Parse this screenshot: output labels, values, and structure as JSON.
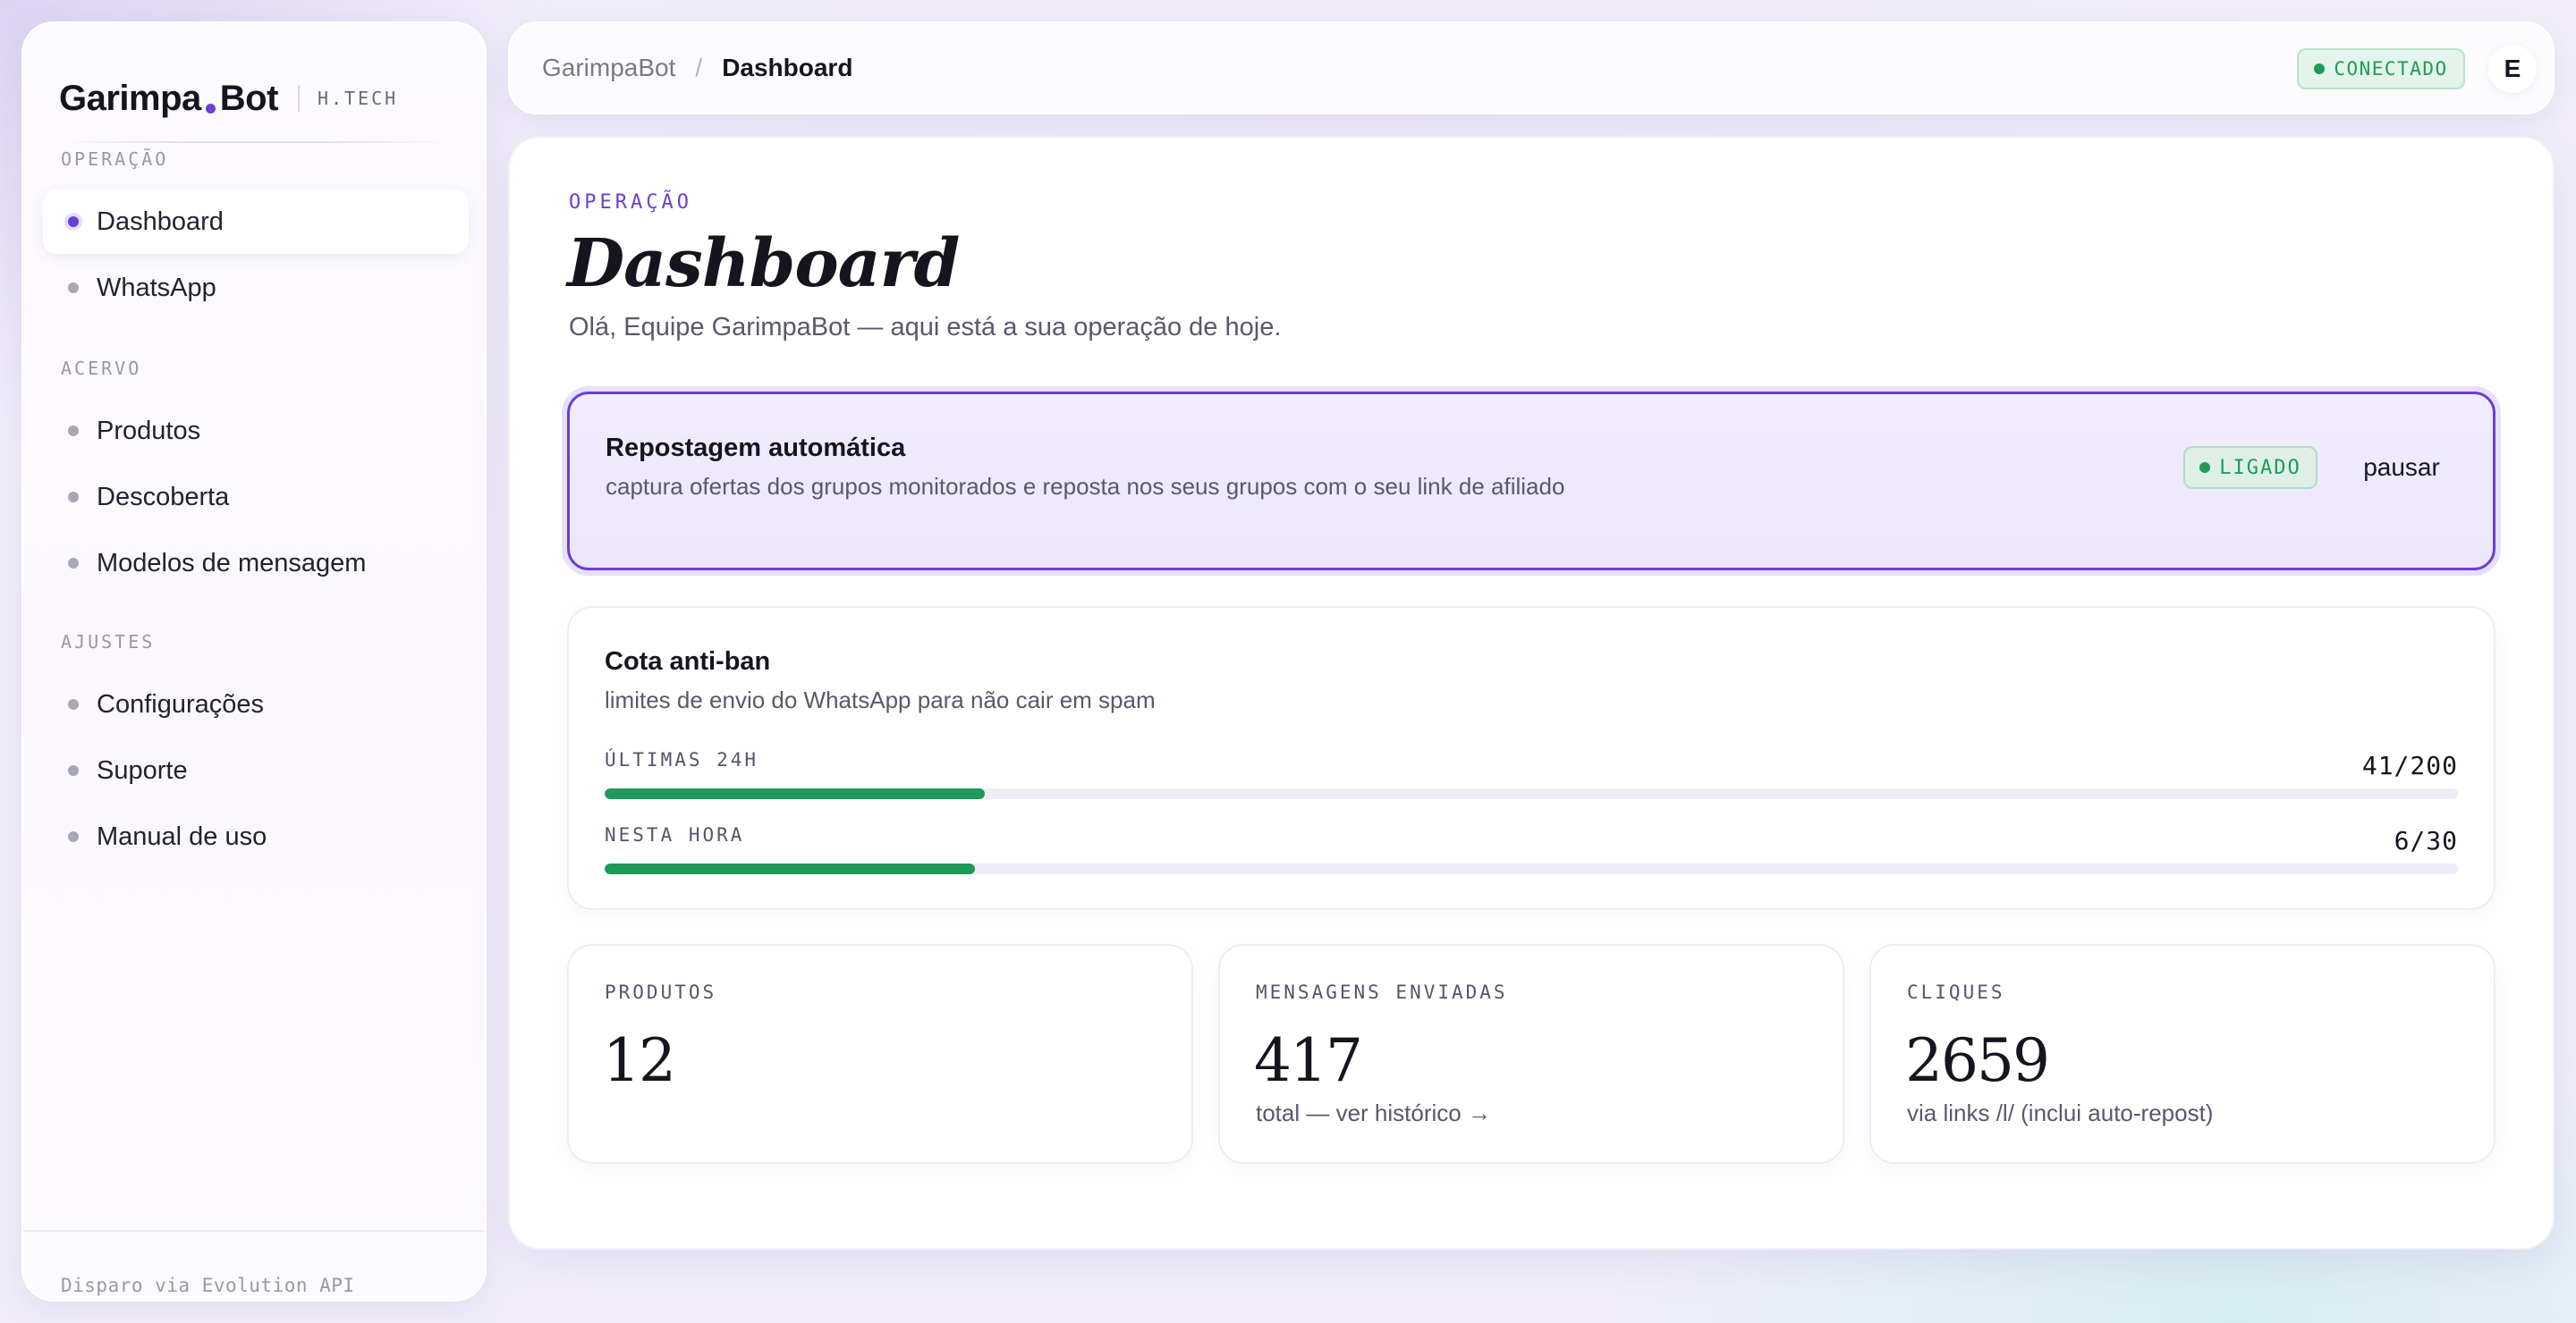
{
  "sidebar": {
    "brand_name_1": "Garimpa",
    "brand_name_2": "Bot",
    "brand_tag": "H.TECH",
    "sections": [
      {
        "label": "OPERAÇÃO",
        "items": [
          {
            "label": "Dashboard",
            "active": true
          },
          {
            "label": "WhatsApp"
          }
        ]
      },
      {
        "label": "ACERVO",
        "items": [
          {
            "label": "Produtos"
          },
          {
            "label": "Descoberta"
          },
          {
            "label": "Modelos de mensagem"
          }
        ]
      },
      {
        "label": "AJUSTES",
        "items": [
          {
            "label": "Configurações"
          },
          {
            "label": "Suporte"
          },
          {
            "label": "Manual de uso"
          }
        ]
      }
    ],
    "footer": "Disparo via Evolution API"
  },
  "topbar": {
    "breadcrumb_root": "GarimpaBot",
    "breadcrumb_sep": "/",
    "breadcrumb_current": "Dashboard",
    "status": "CONECTADO",
    "avatar_initial": "E"
  },
  "main": {
    "eyebrow": "OPERAÇÃO",
    "title": "Dashboard",
    "subtitle": "Olá, Equipe GarimpaBot — aqui está a sua operação de hoje.",
    "auto_repost": {
      "title": "Repostagem automática",
      "description": "captura ofertas dos grupos monitorados e reposta nos seus grupos com o seu link de afiliado",
      "status": "LIGADO",
      "action": "pausar"
    },
    "quota": {
      "title": "Cota anti-ban",
      "description": "limites de envio do WhatsApp para não cair em spam",
      "rows": [
        {
          "label": "ÚLTIMAS 24H",
          "value": "41/200",
          "used": 41,
          "limit": 200
        },
        {
          "label": "NESTA HORA",
          "value": "6/30",
          "used": 6,
          "limit": 30
        }
      ]
    },
    "stats": [
      {
        "label": "PRODUTOS",
        "value": "12",
        "note": ""
      },
      {
        "label": "MENSAGENS ENVIADAS",
        "value": "417",
        "note": "total — ver histórico →"
      },
      {
        "label": "CLIQUES",
        "value": "2659",
        "note": "via links /l/ (inclui auto-repost)"
      }
    ]
  },
  "colors": {
    "accent": "#6a3fd6",
    "success": "#1f9a5b",
    "background": "#f1eef9"
  },
  "icons": {
    "status_dot": "status-dot-icon",
    "nav_bullet": "bullet-icon"
  }
}
